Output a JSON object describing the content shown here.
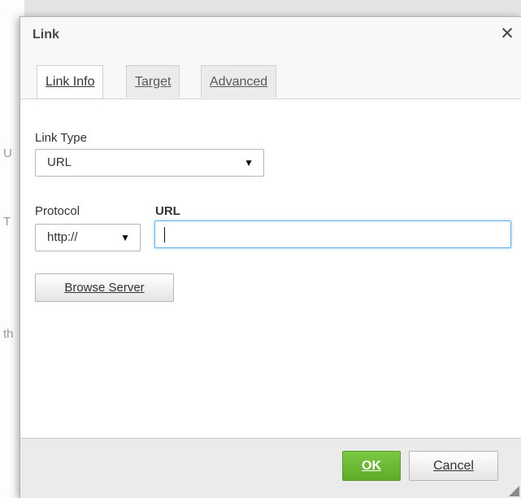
{
  "dialog": {
    "title": "Link",
    "close_icon": "close-icon",
    "tabs": [
      {
        "label": "Link Info",
        "active": true
      },
      {
        "label": "Target",
        "active": false
      },
      {
        "label": "Advanced",
        "active": false
      }
    ]
  },
  "form": {
    "link_type_label": "Link Type",
    "link_type_value": "URL",
    "protocol_label": "Protocol",
    "protocol_value": "http://",
    "url_label": "URL",
    "url_value": "",
    "browse_button": "Browse Server",
    "dropdown_icon": "triangle-down-icon"
  },
  "footer": {
    "ok_label": "OK",
    "cancel_label": "Cancel",
    "resize_icon": "resize-handle-icon"
  },
  "colors": {
    "ok_button": "#6ab433",
    "url_focus_border": "#66afe9"
  }
}
